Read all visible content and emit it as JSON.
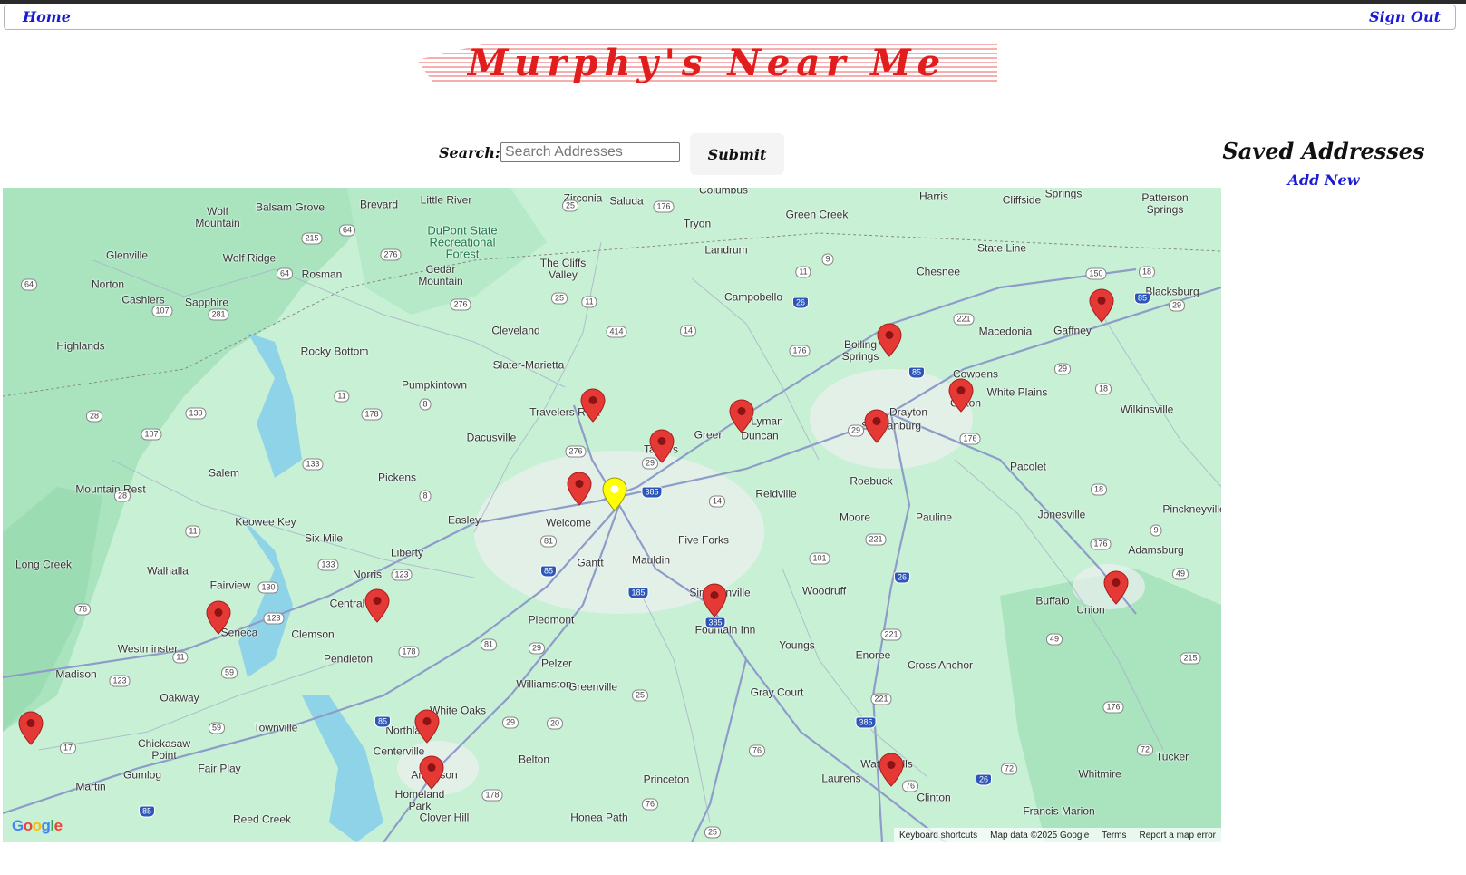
{
  "nav": {
    "home_label": "Home",
    "signout_label": "Sign Out"
  },
  "brand": {
    "title": "Murphy's Near Me"
  },
  "search": {
    "label": "Search:",
    "placeholder": "Search Addresses",
    "value": "",
    "submit_label": "Submit"
  },
  "saved": {
    "title": "Saved Addresses",
    "add_new_label": "Add New"
  },
  "map": {
    "attribution": {
      "logo": "Google",
      "keyboard_shortcuts": "Keyboard shortcuts",
      "map_data": "Map data ©2025 Google",
      "terms": "Terms",
      "report": "Report a map error"
    },
    "places": [
      "Zirconia",
      "Saluda",
      "Columbus",
      "Harris",
      "Cliffside",
      "Springs",
      "Patterson Springs",
      "Brevard",
      "Little River",
      "Wolf Mountain",
      "Balsam Grove",
      "DuPont State Recreational Forest",
      "Tryon",
      "Green Creek",
      "Landrum",
      "State Line",
      "Glenville",
      "Wolf Ridge",
      "Cedar Mountain",
      "The Cliffs Valley",
      "Chesnee",
      "Norton",
      "Cashiers",
      "Sapphire",
      "Rosman",
      "Campobello",
      "Blacksburg",
      "Highlands",
      "Cleveland",
      "Boiling Springs",
      "Macedonia",
      "Gaffney",
      "Rocky Bottom",
      "Slater-Marietta",
      "Cowpens",
      "Pumpkintown",
      "Travelers Rest",
      "White Plains",
      "Greer",
      "Lyman",
      "Drayton",
      "Clifton",
      "Wilkinsville",
      "Dacusville",
      "Taylors",
      "Duncan",
      "Spartanburg",
      "Salem",
      "Pickens",
      "Roebuck",
      "Reidville",
      "Pacolet",
      "Mountain Rest",
      "Greenville",
      "Easley",
      "Welcome",
      "Keowee Key",
      "Moore",
      "Pauline",
      "Jonesville",
      "Pinckneyville",
      "Six Mile",
      "Liberty",
      "Five Forks",
      "Mauldin",
      "Adamsburg",
      "Long Creek",
      "Gantt",
      "Walhalla",
      "Norris",
      "Fairview",
      "Central",
      "Woodruff",
      "Buffalo",
      "Union",
      "Seneca",
      "Clemson",
      "Piedmont",
      "Simpsonville",
      "Fountain Inn",
      "Westminster",
      "Pendleton",
      "Youngs",
      "Pelzer",
      "Enoree",
      "Cross Anchor",
      "Madison",
      "Williamston",
      "Oakway",
      "Gray Court",
      "White Oaks",
      "Townville",
      "Northlake",
      "Chickasaw Point",
      "Centerville",
      "Belton",
      "Tucker",
      "Fair Play",
      "Watts Mills",
      "Laurens",
      "Princeton",
      "Whitmire",
      "Gumlog",
      "Martin",
      "Anderson",
      "Homeland Park",
      "Clinton",
      "Clover Hill",
      "Honea Path",
      "Francis Marion",
      "Reed Creek"
    ],
    "pins": [
      {
        "label": "saved-location-travelers-rest",
        "color": "#e53935"
      },
      {
        "label": "saved-location-taylors",
        "color": "#e53935"
      },
      {
        "label": "saved-location-greer",
        "color": "#e53935"
      },
      {
        "label": "saved-location-boiling-springs",
        "color": "#e53935"
      },
      {
        "label": "saved-location-spartanburg",
        "color": "#e53935"
      },
      {
        "label": "saved-location-drayton",
        "color": "#e53935"
      },
      {
        "label": "saved-location-gaffney",
        "color": "#e53935"
      },
      {
        "label": "saved-location-greenville-west",
        "color": "#e53935"
      },
      {
        "label": "current-location-greenville",
        "color": "#ffff00"
      },
      {
        "label": "saved-location-simpsonville",
        "color": "#e53935"
      },
      {
        "label": "saved-location-union",
        "color": "#e53935"
      },
      {
        "label": "saved-location-central",
        "color": "#e53935"
      },
      {
        "label": "saved-location-seneca",
        "color": "#e53935"
      },
      {
        "label": "saved-location-westernmost",
        "color": "#e53935"
      },
      {
        "label": "saved-location-northlake",
        "color": "#e53935"
      },
      {
        "label": "saved-location-anderson",
        "color": "#e53935"
      },
      {
        "label": "saved-location-watts-mills",
        "color": "#e53935"
      }
    ]
  },
  "colors": {
    "brand_red": "#e21d1d",
    "link_blue": "#1a1ad6",
    "map_land": "#c8f0d5",
    "pin_red": "#e53935",
    "pin_current": "#ffff00"
  }
}
